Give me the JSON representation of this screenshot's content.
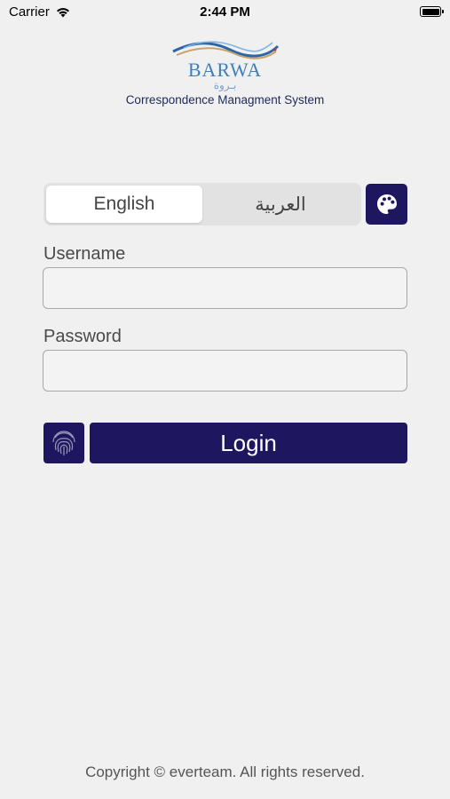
{
  "status_bar": {
    "carrier": "Carrier",
    "time": "2:44 PM",
    "battery_level": 1.0
  },
  "logo": {
    "wordmark": "BARWA",
    "arabic": "بـروة",
    "subtitle": "Correspondence Managment System"
  },
  "language": {
    "options": [
      "English",
      "العربية"
    ],
    "selected": "English"
  },
  "form": {
    "username_label": "Username",
    "username_value": "",
    "password_label": "Password",
    "password_value": ""
  },
  "buttons": {
    "login_label": "Login",
    "theme_icon": "palette-icon",
    "biometric_icon": "fingerprint-icon"
  },
  "footer": {
    "copyright": "Copyright © everteam. All rights reserved."
  },
  "colors": {
    "primary": "#1e1760",
    "background": "#f0f0f0",
    "logo_blue": "#3f7fb8"
  }
}
